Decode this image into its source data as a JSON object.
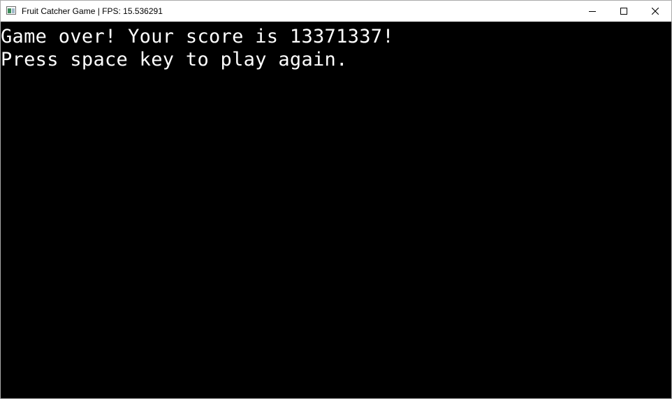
{
  "window": {
    "title": "Fruit Catcher Game | FPS: 15.536291",
    "icon": "app-window-icon",
    "controls": {
      "minimize_icon": "minimize-icon",
      "maximize_icon": "maximize-icon",
      "close_icon": "close-icon"
    }
  },
  "game": {
    "background_color": "#000000",
    "text_color": "#ffffff",
    "game_over_message": "Game over! Your score is 13371337!",
    "restart_prompt": "Press space key to play again."
  }
}
